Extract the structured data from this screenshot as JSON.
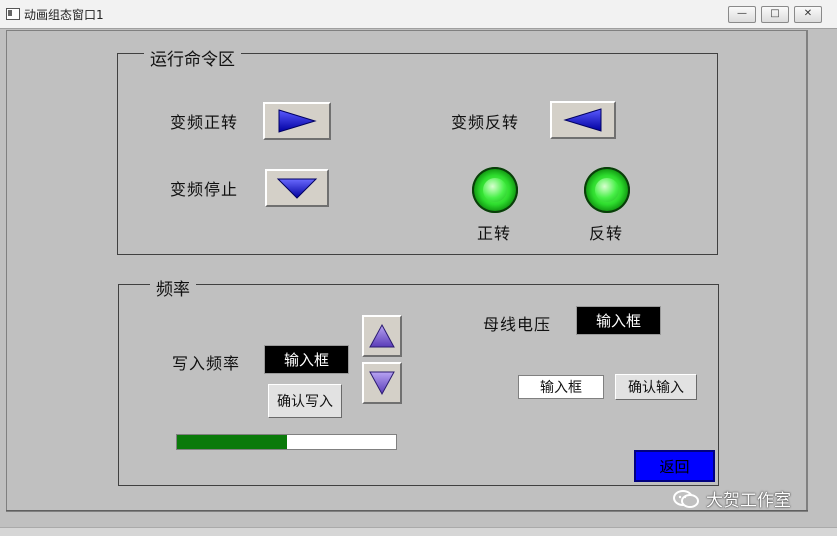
{
  "window": {
    "title": "动画组态窗口1",
    "min_glyph": "—",
    "max_glyph": "□",
    "close_glyph": "✕"
  },
  "run_group": {
    "title": "运行命令区",
    "forward_label": "变频正转",
    "reverse_label": "变频反转",
    "stop_label": "变频停止",
    "forward_lamp_label": "正转",
    "reverse_lamp_label": "反转"
  },
  "freq_group": {
    "title": "频率",
    "write_freq_label": "写入频率",
    "write_freq_box": "输入框",
    "confirm_write": "确认写入",
    "bus_voltage_label": "母线电压",
    "bus_voltage_box": "输入框",
    "input_box": "输入框",
    "confirm_input": "确认输入",
    "progress": 0.5
  },
  "return_button": "返回",
  "watermark": "大贺工作室",
  "colors": {
    "panel_bg": "#c0c0c0",
    "arrow_blue": "#1a1adc",
    "arrow_purple": "#8a6ad8",
    "lamp_green": "#2ddc2d",
    "progress_green": "#0a7a0a",
    "return_blue": "#0000ff"
  },
  "icons": {
    "forward": "right-triangle-icon",
    "reverse": "left-triangle-icon",
    "stop": "down-triangle-icon",
    "up": "up-triangle-icon",
    "down": "down-triangle-icon"
  }
}
